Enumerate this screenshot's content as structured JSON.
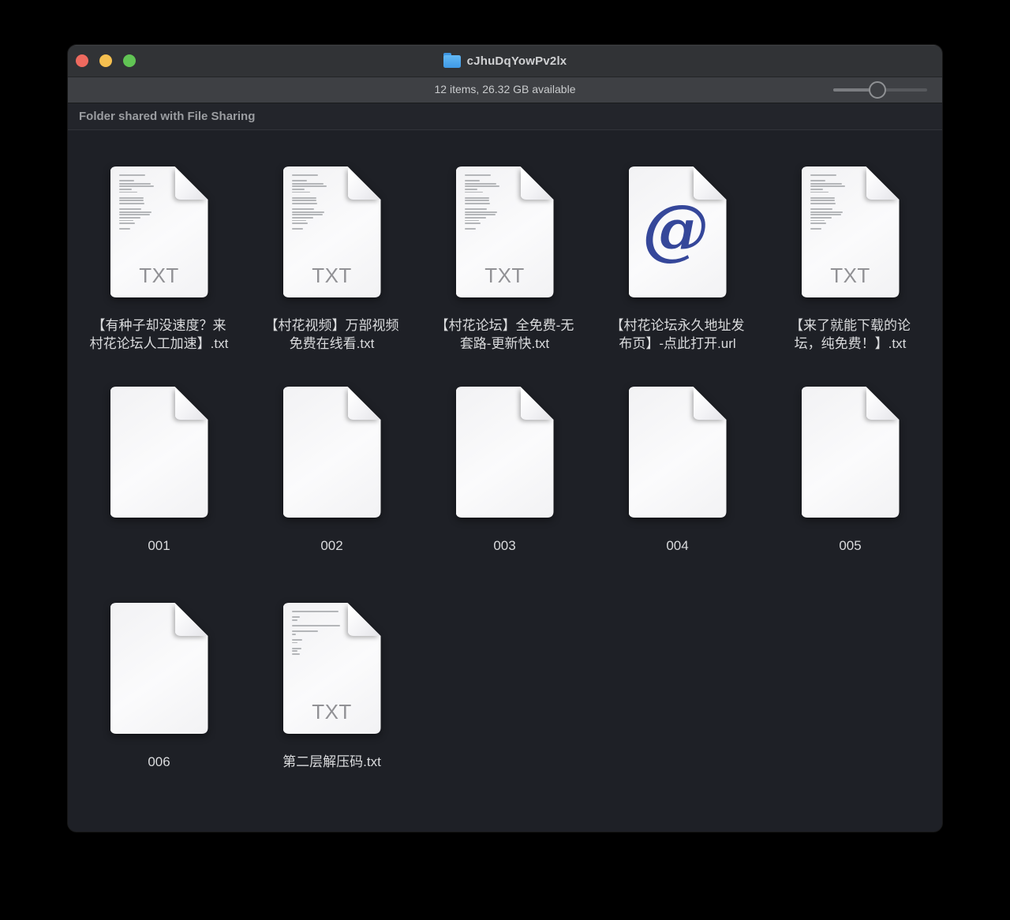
{
  "window": {
    "title": "cJhuDqYowPv2lx",
    "status": "12 items, 26.32 GB available",
    "banner": "Folder shared with File Sharing",
    "slider_value_percent": 47
  },
  "colors": {
    "close_button": "#ee6a5f",
    "minimize_button": "#f5bf4f",
    "zoom_button": "#61c454",
    "folder_icon": "#4aa5ee",
    "url_symbol_color": "#35479a",
    "window_background": "#1e2026"
  },
  "icon_art": {
    "txt_badge": "TXT",
    "url_symbol": "@"
  },
  "files": [
    {
      "label": "【有种子却没速度？来\n村花论坛人工加速】.txt",
      "icon": "txt-dense",
      "row": 0
    },
    {
      "label": "【村花视频】万部视频\n免费在线看.txt",
      "icon": "txt-dense",
      "row": 0
    },
    {
      "label": "【村花论坛】全免费-无\n套路-更新快.txt",
      "icon": "txt-dense",
      "row": 0
    },
    {
      "label": "【村花论坛永久地址发\n布页】-点此打开.url",
      "icon": "url",
      "row": 0
    },
    {
      "label": "【来了就能下载的论\n坛，纯免费！】.txt",
      "icon": "txt-dense",
      "row": 0
    },
    {
      "label": "001",
      "icon": "blank",
      "row": 1
    },
    {
      "label": "002",
      "icon": "blank",
      "row": 1
    },
    {
      "label": "003",
      "icon": "blank",
      "row": 1
    },
    {
      "label": "004",
      "icon": "blank",
      "row": 1
    },
    {
      "label": "005",
      "icon": "blank",
      "row": 1
    },
    {
      "label": "006",
      "icon": "blank",
      "row": 2
    },
    {
      "label": "第二层解压码.txt",
      "icon": "txt-light",
      "row": 2
    }
  ]
}
